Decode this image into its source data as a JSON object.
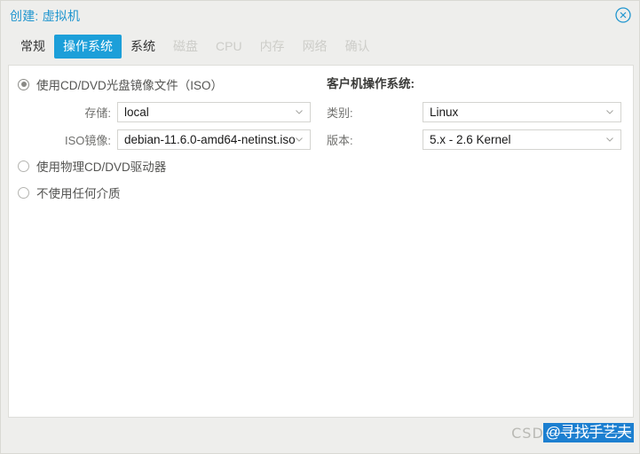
{
  "window": {
    "title": "创建: 虚拟机",
    "close_icon": "close-circle-icon"
  },
  "tabs": [
    {
      "label": "常规",
      "state": "normal"
    },
    {
      "label": "操作系统",
      "state": "active"
    },
    {
      "label": "系统",
      "state": "normal"
    },
    {
      "label": "磁盘",
      "state": "disabled"
    },
    {
      "label": "CPU",
      "state": "disabled"
    },
    {
      "label": "内存",
      "state": "disabled"
    },
    {
      "label": "网络",
      "state": "disabled"
    },
    {
      "label": "确认",
      "state": "disabled"
    }
  ],
  "media": {
    "options": [
      {
        "label": "使用CD/DVD光盘镜像文件（ISO）",
        "checked": true
      },
      {
        "label": "使用物理CD/DVD驱动器",
        "checked": false
      },
      {
        "label": "不使用任何介质",
        "checked": false
      }
    ],
    "fields": [
      {
        "label": "存储:",
        "value": "local"
      },
      {
        "label": "ISO镜像:",
        "value": "debian-11.6.0-amd64-netinst.iso"
      }
    ]
  },
  "guest_os": {
    "heading": "客户机操作系统:",
    "fields": [
      {
        "label": "类别:",
        "value": "Linux"
      },
      {
        "label": "版本:",
        "value": "5.x - 2.6 Kernel"
      }
    ]
  },
  "watermark": {
    "brand": "CSDN",
    "handle": "@寻找手艺夫"
  },
  "colors": {
    "accent": "#1c9fd9",
    "title": "#2196cf",
    "watermark_blue": "#1c7fd0",
    "panel_bg": "#ffffff",
    "window_bg": "#eeeeec"
  }
}
